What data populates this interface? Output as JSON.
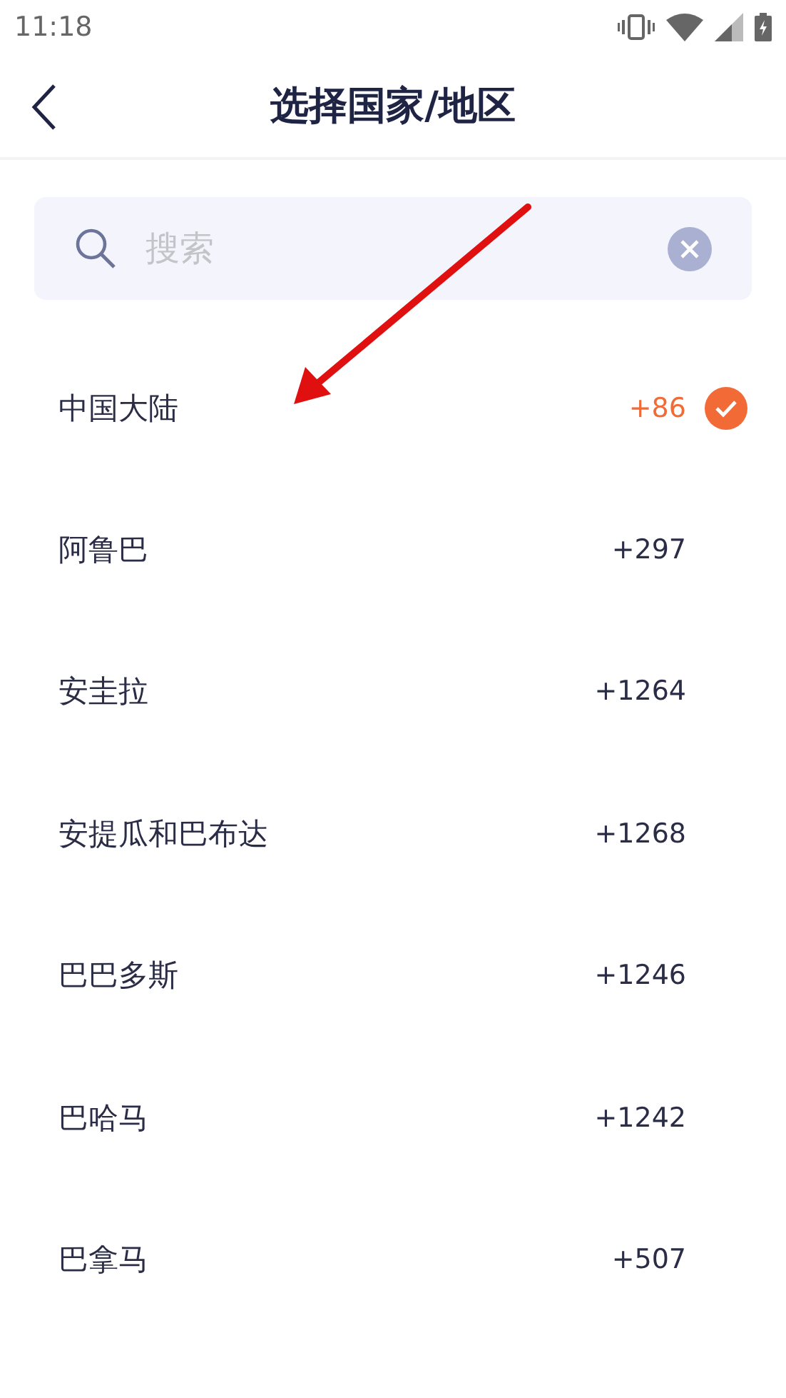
{
  "status_bar": {
    "time": "11:18"
  },
  "header": {
    "title": "选择国家/地区"
  },
  "search": {
    "placeholder": "搜索"
  },
  "countries": [
    {
      "name": "中国大陆",
      "code": "+86",
      "selected": true
    },
    {
      "name": "阿鲁巴",
      "code": "+297",
      "selected": false
    },
    {
      "name": "安圭拉",
      "code": "+1264",
      "selected": false
    },
    {
      "name": "安提瓜和巴布达",
      "code": "+1268",
      "selected": false
    },
    {
      "name": "巴巴多斯",
      "code": "+1246",
      "selected": false
    },
    {
      "name": "巴哈马",
      "code": "+1242",
      "selected": false
    },
    {
      "name": "巴拿马",
      "code": "+507",
      "selected": false
    }
  ]
}
